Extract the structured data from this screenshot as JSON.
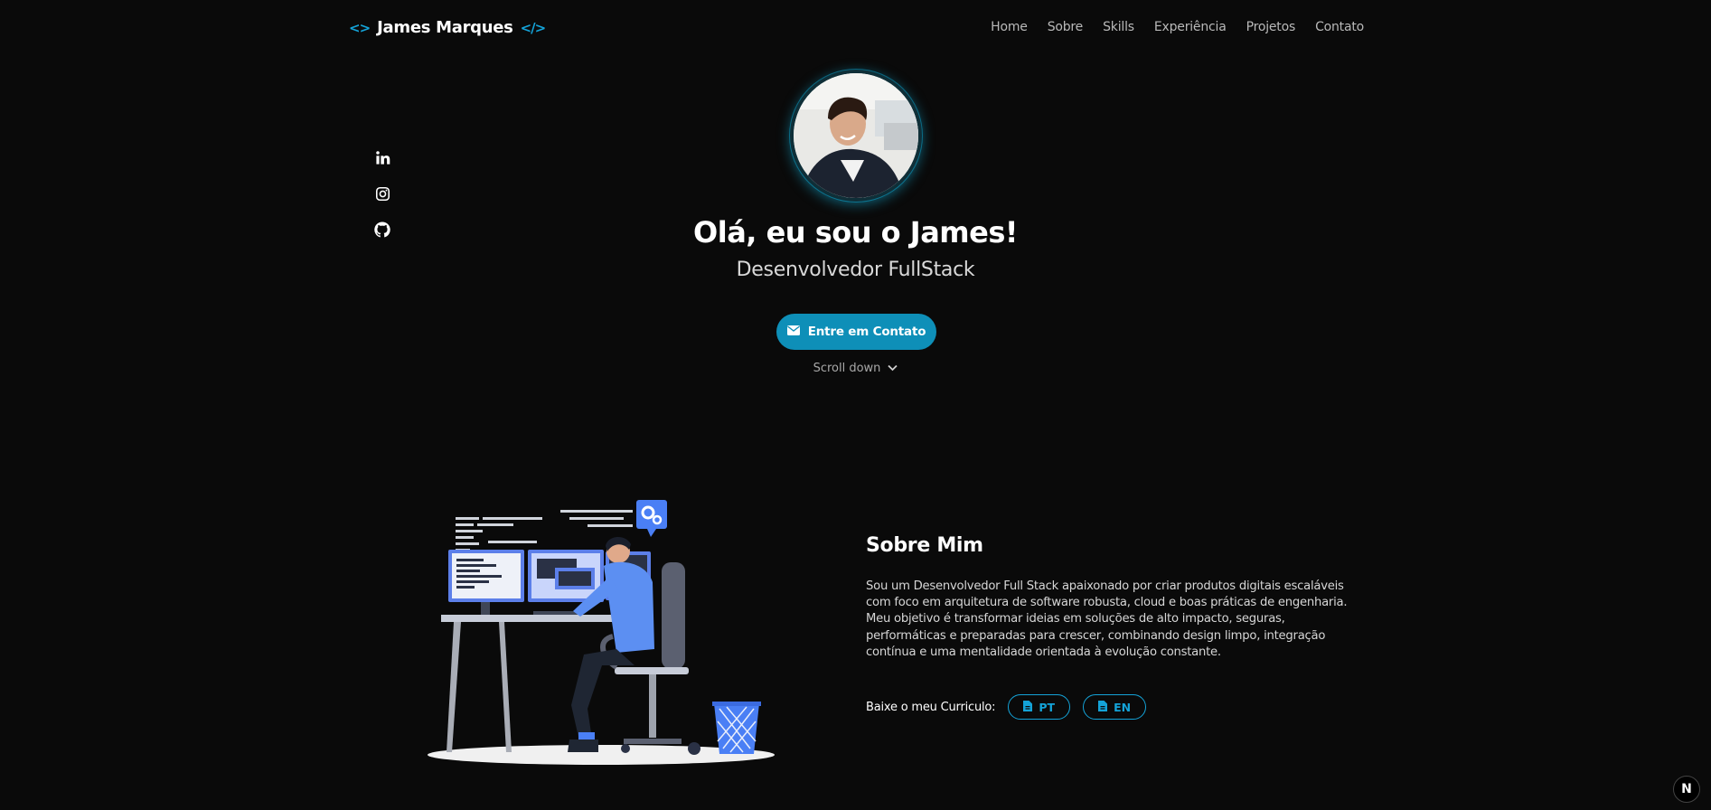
{
  "nav": {
    "brand_open": "<>",
    "brand_name": "James Marques",
    "brand_close": "</>",
    "links": [
      "Home",
      "Sobre",
      "Skills",
      "Experiência",
      "Projetos",
      "Contato"
    ]
  },
  "social": [
    "linkedin-icon",
    "instagram-icon",
    "github-icon"
  ],
  "hero": {
    "title": "Olá, eu sou o James!",
    "subtitle": "Desenvolvedor FullStack",
    "cta_label": "Entre em Contato",
    "scroll_label": "Scroll down"
  },
  "about": {
    "title": "Sobre Mim",
    "text": "Sou um Desenvolvedor Full Stack apaixonado por criar produtos digitais escaláveis com foco em arquitetura de software robusta, cloud e boas práticas de engenharia. Meu objetivo é transformar ideias em soluções de alto impacto, seguras, performáticas e preparadas para crescer, combinando design limpo, integração contínua e uma mentalidade orientada à evolução constante.",
    "cv_label": "Baixe o meu Curriculo:",
    "cv_pt": "PT",
    "cv_en": "EN"
  },
  "badge": "N",
  "colors": {
    "accent": "#14a3d8",
    "cta": "#0e8fb8",
    "background": "#0a0a0a"
  }
}
